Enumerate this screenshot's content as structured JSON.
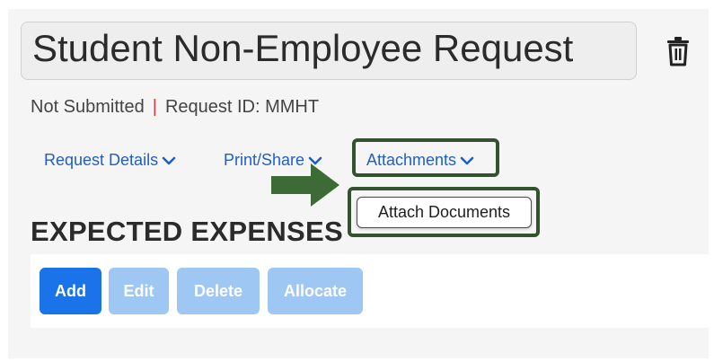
{
  "header": {
    "title": "Student Non-Employee Request",
    "status": "Not Submitted",
    "separator": "|",
    "request_id": "Request ID: MMHT"
  },
  "nav": {
    "request_details": "Request Details",
    "print_share": "Print/Share",
    "attachments": "Attachments"
  },
  "attachments_menu": {
    "items": [
      "Attach Documents"
    ]
  },
  "section": {
    "heading": "EXPECTED EXPENSES"
  },
  "toolbar": {
    "add": "Add",
    "edit": "Edit",
    "delete": "Delete",
    "allocate": "Allocate"
  },
  "colors": {
    "link_blue": "#1f5fc6",
    "primary_button": "#1a73e8",
    "disabled_button": "#9fc7f4",
    "highlight_green": "#33522e",
    "arrow_green": "#3d6b35"
  }
}
